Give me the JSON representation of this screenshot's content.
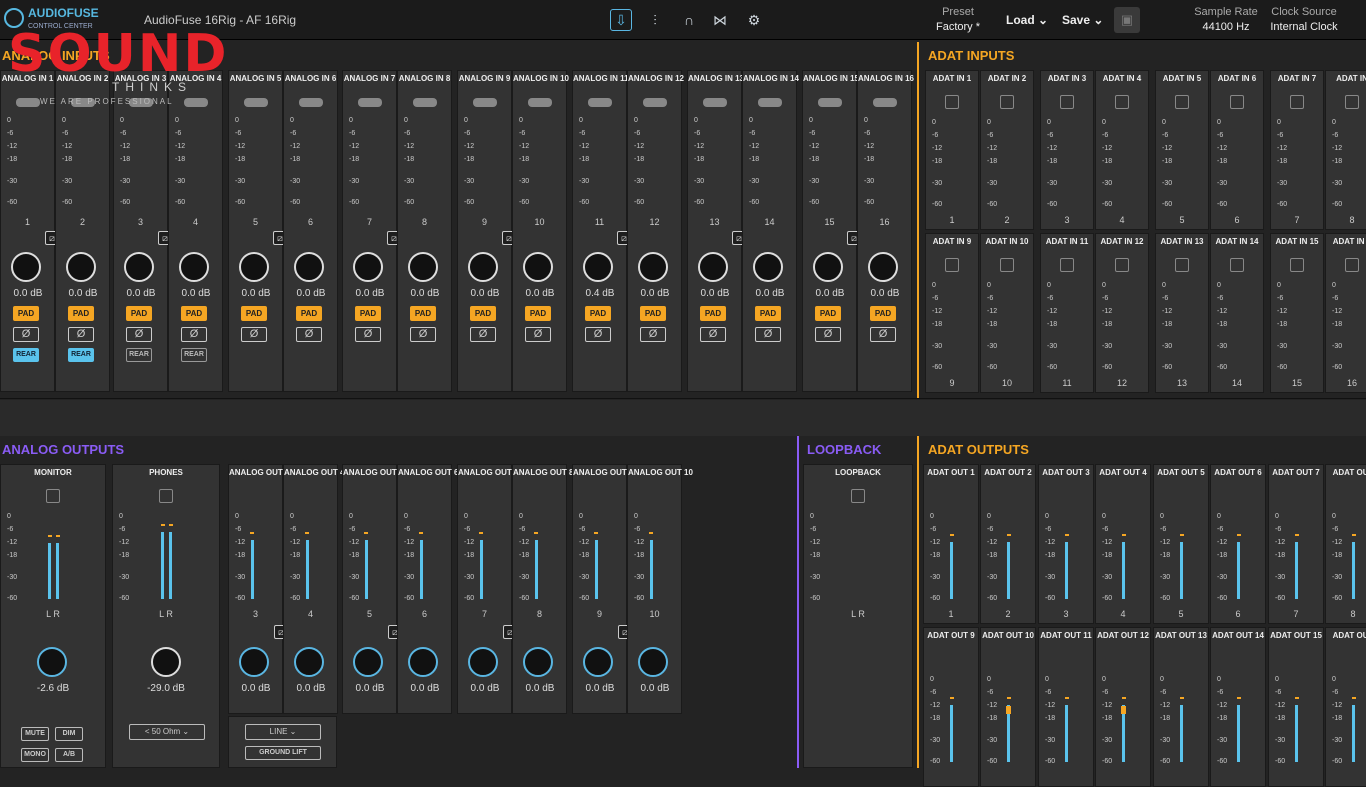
{
  "app": {
    "logo_line1": "AUDIOFUSE",
    "logo_line2": "CONTROL CENTER",
    "title": "AudioFuse 16Rig - AF 16Rig"
  },
  "toolbar": {
    "icons": [
      "mixer-io-icon",
      "faders-icon",
      "headphones-icon",
      "routing-icon",
      "settings-icon"
    ],
    "preset_label": "Preset",
    "preset_value": "Factory *",
    "load": "Load ⌄",
    "save": "Save ⌄",
    "sample_rate_label": "Sample Rate",
    "sample_rate_value": "44100 Hz",
    "clock_label": "Clock Source",
    "clock_value": "Internal Clock"
  },
  "watermark": {
    "brand": "SOUND",
    "sub": "THINKS",
    "tag": "WE ARE PROFESSIONAL"
  },
  "meter_ticks": [
    "0",
    "-6",
    "-12",
    "-18",
    "-30",
    "-60"
  ],
  "analog_inputs": {
    "title": "ANALOG INPUTS",
    "channels": [
      {
        "name": "ANALOG IN 1",
        "num": "1",
        "db": "0.0 dB",
        "pad": "PAD",
        "phase": "Ø",
        "rear": "REAR",
        "rear_on": true
      },
      {
        "name": "ANALOG IN 2",
        "num": "2",
        "db": "0.0 dB",
        "pad": "PAD",
        "phase": "Ø",
        "rear": "REAR",
        "rear_on": true
      },
      {
        "name": "ANALOG IN 3",
        "num": "3",
        "db": "0.0 dB",
        "pad": "PAD",
        "phase": "Ø",
        "rear": "REAR",
        "rear_on": false
      },
      {
        "name": "ANALOG IN 4",
        "num": "4",
        "db": "0.0 dB",
        "pad": "PAD",
        "phase": "Ø",
        "rear": "REAR",
        "rear_on": false
      },
      {
        "name": "ANALOG IN 5",
        "num": "5",
        "db": "0.0 dB",
        "pad": "PAD",
        "phase": "Ø"
      },
      {
        "name": "ANALOG IN 6",
        "num": "6",
        "db": "0.0 dB",
        "pad": "PAD",
        "phase": "Ø"
      },
      {
        "name": "ANALOG IN 7",
        "num": "7",
        "db": "0.0 dB",
        "pad": "PAD",
        "phase": "Ø"
      },
      {
        "name": "ANALOG IN 8",
        "num": "8",
        "db": "0.0 dB",
        "pad": "PAD",
        "phase": "Ø"
      },
      {
        "name": "ANALOG IN 9",
        "num": "9",
        "db": "0.0 dB",
        "pad": "PAD",
        "phase": "Ø"
      },
      {
        "name": "ANALOG IN 10",
        "num": "10",
        "db": "0.0 dB",
        "pad": "PAD",
        "phase": "Ø"
      },
      {
        "name": "ANALOG IN 11",
        "num": "11",
        "db": "0.4 dB",
        "pad": "PAD",
        "phase": "Ø"
      },
      {
        "name": "ANALOG IN 12",
        "num": "12",
        "db": "0.0 dB",
        "pad": "PAD",
        "phase": "Ø"
      },
      {
        "name": "ANALOG IN 13",
        "num": "13",
        "db": "0.0 dB",
        "pad": "PAD",
        "phase": "Ø"
      },
      {
        "name": "ANALOG IN 14",
        "num": "14",
        "db": "0.0 dB",
        "pad": "PAD",
        "phase": "Ø"
      },
      {
        "name": "ANALOG IN 15",
        "num": "15",
        "db": "0.0 dB",
        "pad": "PAD",
        "phase": "Ø"
      },
      {
        "name": "ANALOG IN 16",
        "num": "16",
        "db": "0.0 dB",
        "pad": "PAD",
        "phase": "Ø"
      }
    ]
  },
  "adat_inputs": {
    "title": "ADAT INPUTS",
    "row1": [
      {
        "name": "ADAT IN 1",
        "num": "1"
      },
      {
        "name": "ADAT IN 2",
        "num": "2"
      },
      {
        "name": "ADAT IN 3",
        "num": "3"
      },
      {
        "name": "ADAT IN 4",
        "num": "4"
      },
      {
        "name": "ADAT IN 5",
        "num": "5"
      },
      {
        "name": "ADAT IN 6",
        "num": "6"
      },
      {
        "name": "ADAT IN 7",
        "num": "7"
      },
      {
        "name": "ADAT IN",
        "num": "8"
      }
    ],
    "row2": [
      {
        "name": "ADAT IN 9",
        "num": "9"
      },
      {
        "name": "ADAT IN 10",
        "num": "10"
      },
      {
        "name": "ADAT IN 11",
        "num": "11"
      },
      {
        "name": "ADAT IN 12",
        "num": "12"
      },
      {
        "name": "ADAT IN 13",
        "num": "13"
      },
      {
        "name": "ADAT IN 14",
        "num": "14"
      },
      {
        "name": "ADAT IN 15",
        "num": "15"
      },
      {
        "name": "ADAT IN 1",
        "num": "16"
      }
    ]
  },
  "analog_outputs": {
    "title": "ANALOG OUTPUTS",
    "monitor": {
      "name": "MONITOR",
      "lr": "L R",
      "db": "-2.6 dB",
      "mute": "MUTE",
      "dim": "DIM",
      "mono": "MONO",
      "ab": "A/B"
    },
    "phones": {
      "name": "PHONES",
      "lr": "L R",
      "db": "-29.0 dB",
      "impedance": "< 50 Ohm ⌄"
    },
    "channels": [
      {
        "name": "ANALOG OUT 3",
        "num": "3",
        "db": "0.0 dB"
      },
      {
        "name": "ANALOG OUT 4",
        "num": "4",
        "db": "0.0 dB"
      },
      {
        "name": "ANALOG OUT 5",
        "num": "5",
        "db": "0.0 dB"
      },
      {
        "name": "ANALOG OUT 6",
        "num": "6",
        "db": "0.0 dB"
      },
      {
        "name": "ANALOG OUT 7",
        "num": "7",
        "db": "0.0 dB"
      },
      {
        "name": "ANALOG OUT 8",
        "num": "8",
        "db": "0.0 dB"
      },
      {
        "name": "ANALOG OUT 9",
        "num": "9",
        "db": "0.0 dB"
      },
      {
        "name": "ANALOG OUT 10",
        "num": "10",
        "db": "0.0 dB"
      }
    ],
    "line_select": "LINE ⌄",
    "ground_lift": "GROUND LIFT"
  },
  "loopback": {
    "title": "LOOPBACK",
    "name": "LOOPBACK",
    "lr": "L R"
  },
  "adat_outputs": {
    "title": "ADAT OUTPUTS",
    "row1": [
      {
        "name": "ADAT OUT 1",
        "num": "1"
      },
      {
        "name": "ADAT OUT 2",
        "num": "2"
      },
      {
        "name": "ADAT OUT 3",
        "num": "3"
      },
      {
        "name": "ADAT OUT 4",
        "num": "4"
      },
      {
        "name": "ADAT OUT 5",
        "num": "5"
      },
      {
        "name": "ADAT OUT 6",
        "num": "6"
      },
      {
        "name": "ADAT OUT 7",
        "num": "7"
      },
      {
        "name": "ADAT OUT",
        "num": "8"
      }
    ],
    "row2": [
      {
        "name": "ADAT OUT 9",
        "num": ""
      },
      {
        "name": "ADAT OUT 10",
        "num": ""
      },
      {
        "name": "ADAT OUT 11",
        "num": ""
      },
      {
        "name": "ADAT OUT 12",
        "num": ""
      },
      {
        "name": "ADAT OUT 13",
        "num": ""
      },
      {
        "name": "ADAT OUT 14",
        "num": ""
      },
      {
        "name": "ADAT OUT 15",
        "num": ""
      },
      {
        "name": "ADAT OUT",
        "num": ""
      }
    ]
  },
  "colors": {
    "accent_blue": "#5ac3ec",
    "pad_orange": "#f5a623",
    "analog_purple": "#8a5cf5",
    "adat_orange": "#f5a623"
  }
}
